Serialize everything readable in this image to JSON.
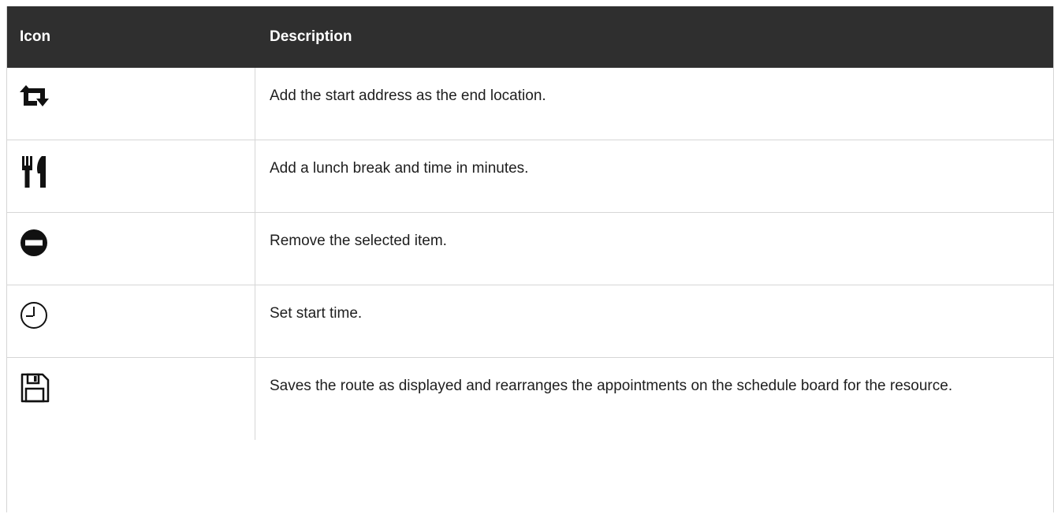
{
  "table": {
    "headers": {
      "icon": "Icon",
      "description": "Description"
    },
    "rows": [
      {
        "icon": "swap-arrows-icon",
        "description": "Add the start address as the end location."
      },
      {
        "icon": "fork-knife-icon",
        "description": "Add a lunch break and time in minutes."
      },
      {
        "icon": "remove-circle-icon",
        "description": "Remove the selected item."
      },
      {
        "icon": "clock-icon",
        "description": "Set start time."
      },
      {
        "icon": "save-disk-icon",
        "description": "Saves the route as displayed and rearranges the appointments on the schedule board for the resource."
      }
    ]
  }
}
